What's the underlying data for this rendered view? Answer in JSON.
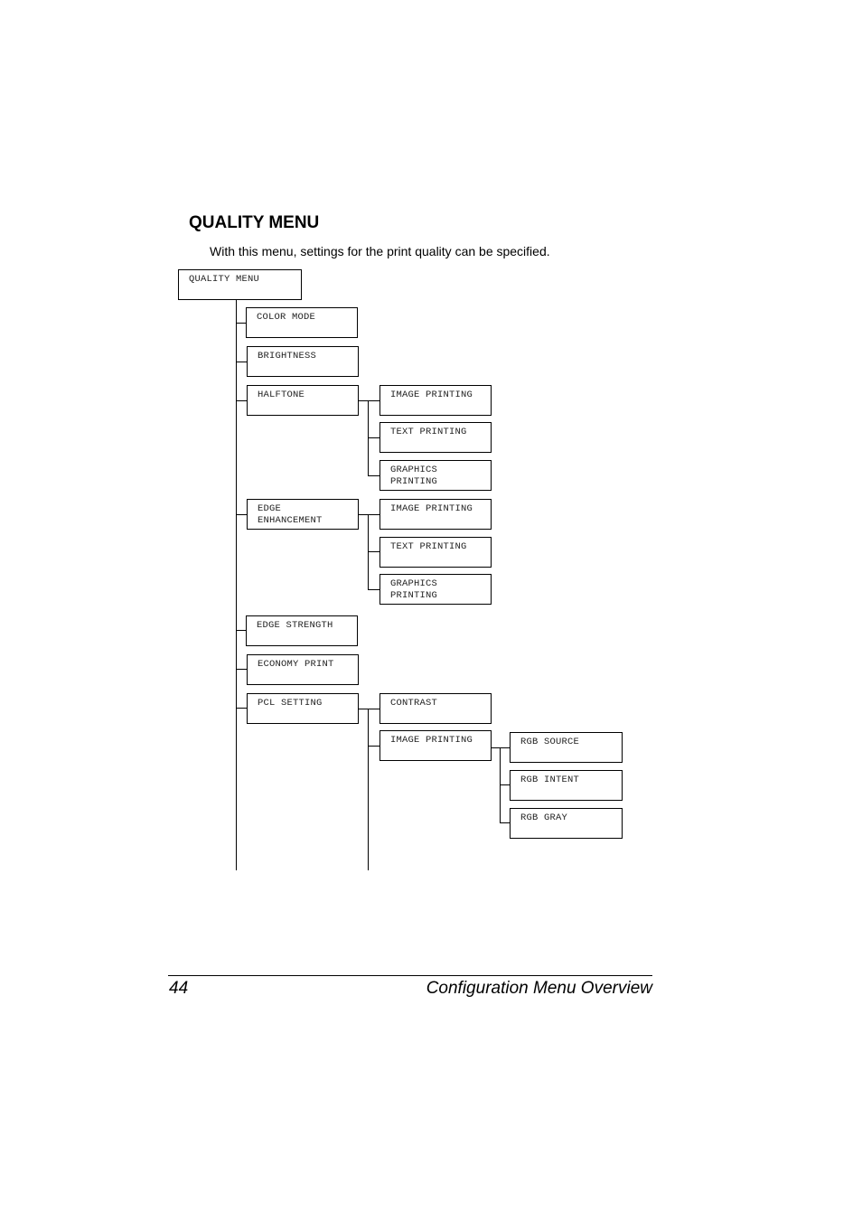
{
  "section": {
    "title": "QUALITY MENU",
    "intro": "With this menu, settings for the print quality can be specified."
  },
  "tree": {
    "root": "QUALITY MENU",
    "items": {
      "color_mode": "COLOR MODE",
      "brightness": "BRIGHTNESS",
      "halftone": "HALFTONE",
      "halftone_children": [
        "IMAGE PRINTING",
        "TEXT PRINTING",
        "GRAPHICS\nPRINTING"
      ],
      "edge_enhancement": "EDGE\nENHANCEMENT",
      "edge_enhancement_children": [
        "IMAGE PRINTING",
        "TEXT PRINTING",
        "GRAPHICS\nPRINTING"
      ],
      "edge_strength": "EDGE STRENGTH",
      "economy_print": "ECONOMY PRINT",
      "pcl_setting": "PCL SETTING",
      "pcl_children": [
        "CONTRAST",
        "IMAGE PRINTING"
      ],
      "pcl_image_children": [
        "RGB SOURCE",
        "RGB INTENT",
        "RGB GRAY"
      ]
    }
  },
  "footer": {
    "page_number": "44",
    "chapter_title": "Configuration Menu Overview"
  }
}
